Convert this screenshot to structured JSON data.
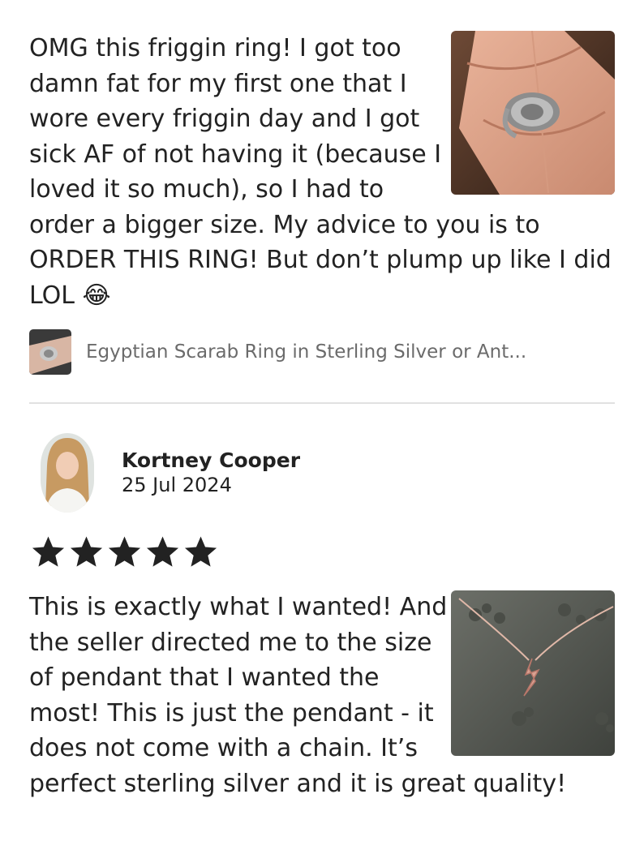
{
  "reviews": [
    {
      "text": "OMG this friggin ring! I got too damn fat for my first one that I wore every friggin day and I got sick AF of not having it (because I loved it so much), so I had to order a bigger size. My advice to you is to ORDER THIS RING! But don’t plump up like I did LOL",
      "emoji": "😂",
      "photo_icon": "ring-on-hand-photo",
      "product": {
        "title": "Egyptian Scarab Ring in Sterling Silver or Ant...",
        "thumb_icon": "ring-thumbnail"
      }
    },
    {
      "reviewer_name": "Kortney Cooper",
      "date": "25 Jul 2024",
      "rating": 5,
      "rating_max": 5,
      "text": "This is exactly what I wanted! And the seller directed me to the size of pendant that I wanted the most! This is just the pendant - it does not come with a chain. It’s perfect sterling silver and it is great quality!",
      "photo_icon": "pendant-photo"
    }
  ],
  "colors": {
    "text": "#222222",
    "muted_text": "#6b6b6b",
    "divider": "#e1e1e1",
    "star": "#222222"
  }
}
